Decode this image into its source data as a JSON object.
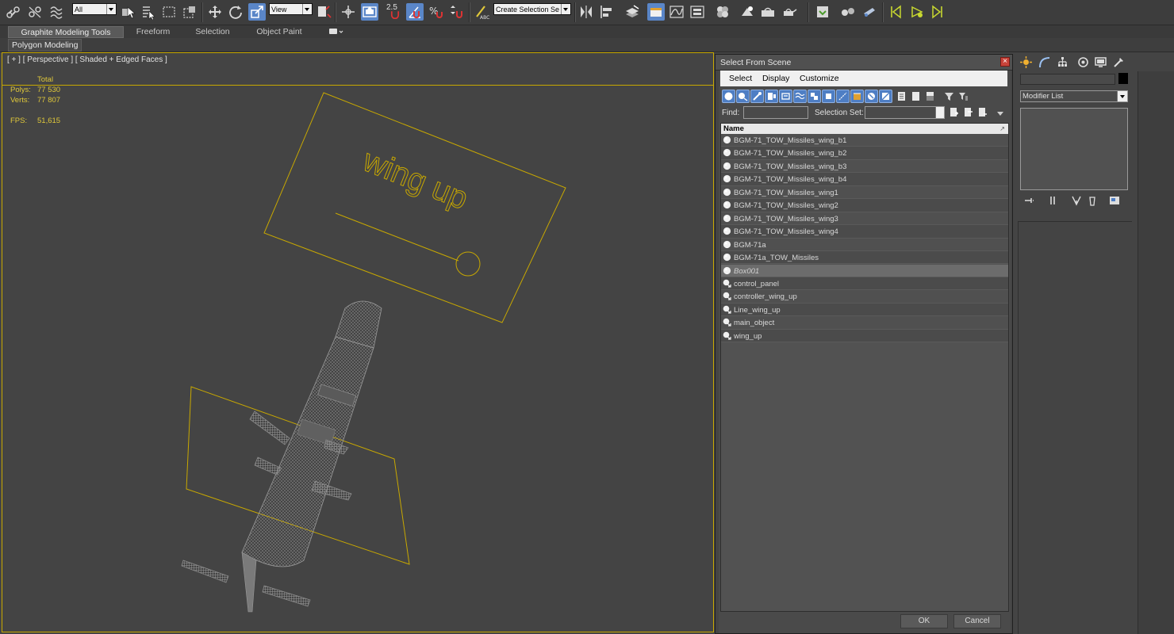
{
  "toolbar": {
    "selection_filter": "All",
    "reference_coord": "View",
    "snap_value": "2.5",
    "named_selection_placeholder": "Create Selection Se"
  },
  "ribbon": {
    "tabs": [
      "Graphite Modeling Tools",
      "Freeform",
      "Selection",
      "Object Paint"
    ],
    "active_tab": "Graphite Modeling Tools",
    "panel_label": "Polygon Modeling"
  },
  "viewport": {
    "label": "[ + ] [ Perspective ] [ Shaded + Edged Faces ]",
    "stats": {
      "total_label": "Total",
      "polys_label": "Polys:",
      "polys_value": "77 530",
      "verts_label": "Verts:",
      "verts_value": "77 807",
      "fps_label": "FPS:",
      "fps_value": "51,615"
    },
    "scene_text": "wing up",
    "colors": {
      "wire_yellow": "#c8a800",
      "mesh_gray": "#8a8a8a"
    }
  },
  "dialog": {
    "title": "Select From Scene",
    "close_label": "×",
    "menu": [
      "Select",
      "Display",
      "Customize"
    ],
    "find_label": "Find:",
    "selection_set_label": "Selection Set:",
    "column_name": "Name",
    "objects": [
      {
        "name": "BGM-71_TOW_Missiles_wing_b1",
        "type": "geometry"
      },
      {
        "name": "BGM-71_TOW_Missiles_wing_b2",
        "type": "geometry"
      },
      {
        "name": "BGM-71_TOW_Missiles_wing_b3",
        "type": "geometry"
      },
      {
        "name": "BGM-71_TOW_Missiles_wing_b4",
        "type": "geometry"
      },
      {
        "name": "BGM-71_TOW_Missiles_wing1",
        "type": "geometry"
      },
      {
        "name": "BGM-71_TOW_Missiles_wing2",
        "type": "geometry"
      },
      {
        "name": "BGM-71_TOW_Missiles_wing3",
        "type": "geometry"
      },
      {
        "name": "BGM-71_TOW_Missiles_wing4",
        "type": "geometry"
      },
      {
        "name": "BGM-71a",
        "type": "geometry"
      },
      {
        "name": "BGM-71a_TOW_Missiles",
        "type": "geometry"
      },
      {
        "name": "Box001",
        "type": "geometry",
        "selected": true
      },
      {
        "name": "control_panel",
        "type": "shape"
      },
      {
        "name": "controller_wing_up",
        "type": "shape"
      },
      {
        "name": "Line_wing_up",
        "type": "shape"
      },
      {
        "name": "main_object",
        "type": "shape"
      },
      {
        "name": "wing_up",
        "type": "shape"
      }
    ],
    "ok_label": "OK",
    "cancel_label": "Cancel"
  },
  "command_panel": {
    "modifier_list_label": "Modifier List"
  }
}
